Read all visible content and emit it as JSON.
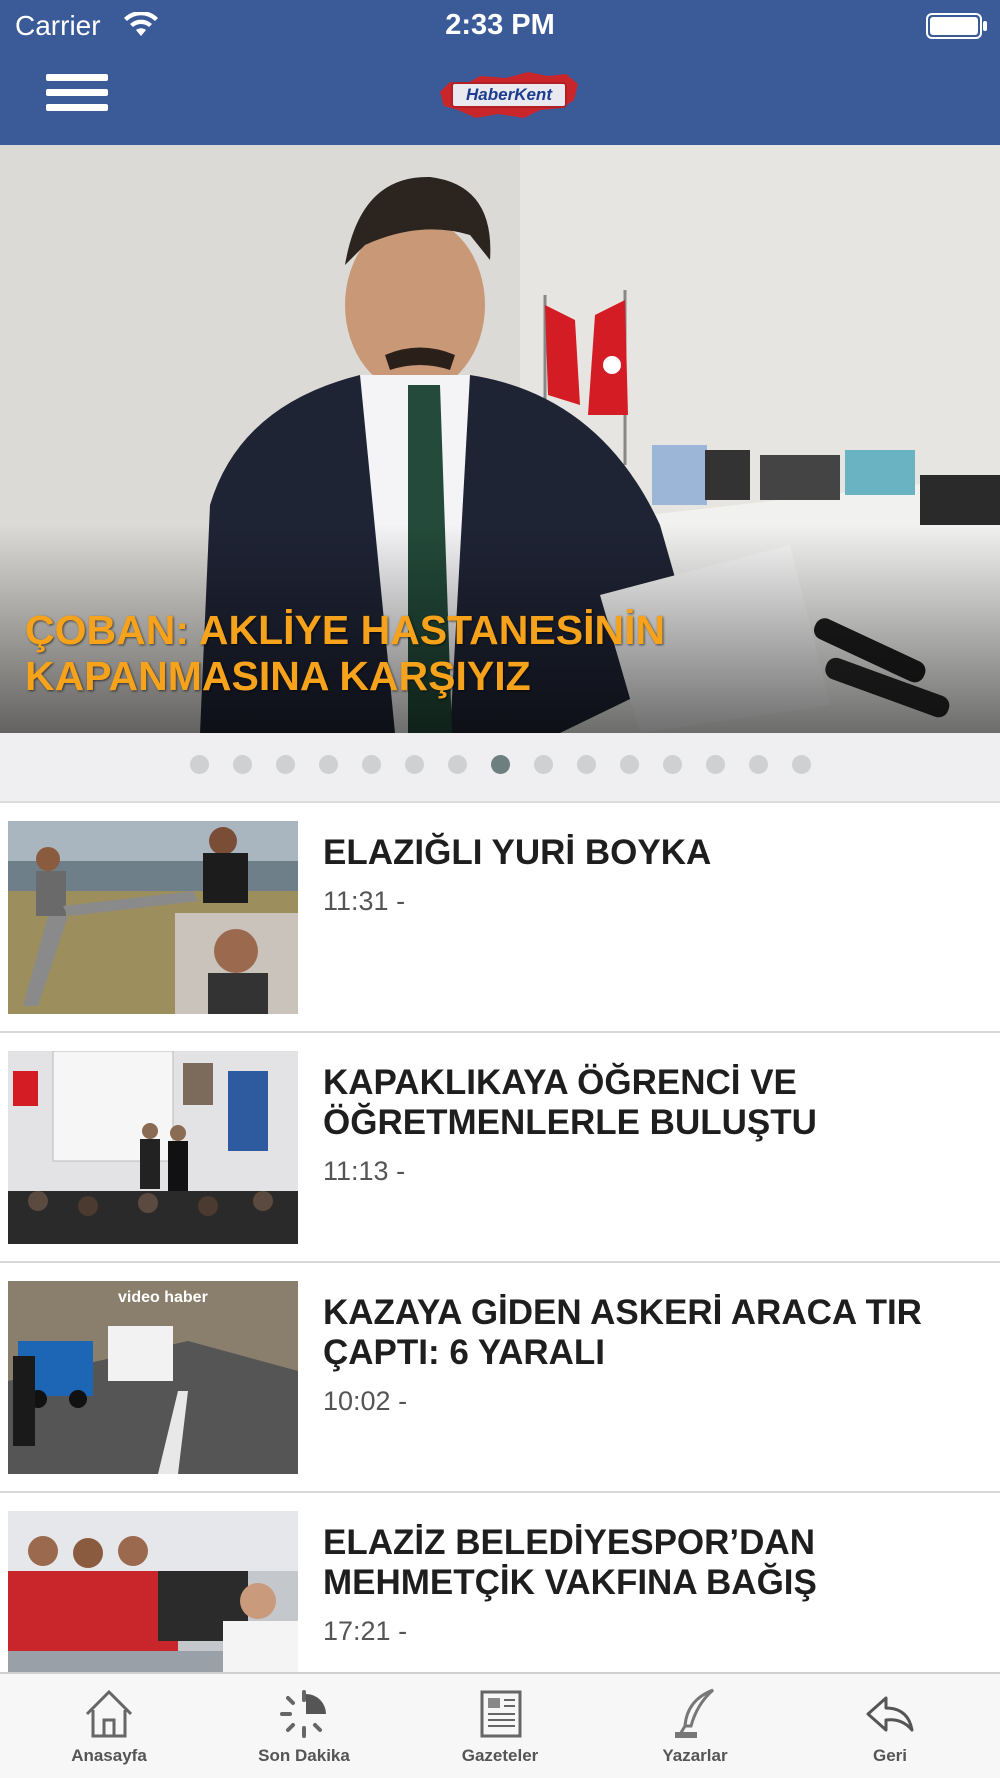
{
  "status_bar": {
    "carrier": "Carrier",
    "time": "2:33 PM"
  },
  "header": {
    "logo_text": "HaberKent"
  },
  "hero": {
    "title": "ÇOBAN: AKLİYE HASTANESİNİN KAPANMASINA KARŞIYIZ",
    "title_color": "#f6a21a",
    "page_count": 15,
    "active_page": 8
  },
  "news": [
    {
      "title": "ELAZIĞLI YURİ BOYKA",
      "time": "11:31 -"
    },
    {
      "title": "KAPAKLIKAYA ÖĞRENCİ VE ÖĞRETMENLERLE BULUŞTU",
      "time": "11:13 -"
    },
    {
      "title": "KAZAYA GİDEN ASKERİ ARACA TIR ÇAPTI: 6 YARALI",
      "time": "10:02 -",
      "thumb_caption": "video haber"
    },
    {
      "title": "ELAZİZ BELEDİYESPOR’DAN MEHMETÇİK VAKFINA BAĞIŞ",
      "time": "17:21 -"
    }
  ],
  "tabs": [
    {
      "label": "Anasayfa",
      "icon": "home-icon"
    },
    {
      "label": "Son Dakika",
      "icon": "spinner-clock-icon"
    },
    {
      "label": "Gazeteler",
      "icon": "newspaper-icon"
    },
    {
      "label": "Yazarlar",
      "icon": "quill-icon"
    },
    {
      "label": "Geri",
      "icon": "back-arrow-icon"
    }
  ],
  "colors": {
    "nav_bar": "#3a5b98",
    "tab_bar": "#f7f7f7",
    "dot_active": "#6e7f80",
    "dot_inactive": "#cfd0d2"
  }
}
